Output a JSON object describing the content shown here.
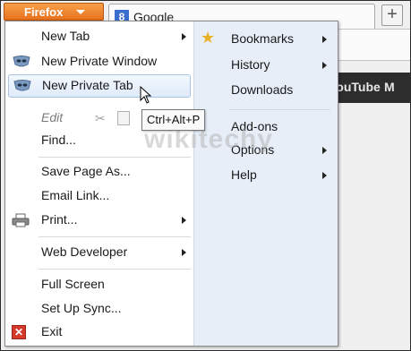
{
  "toolbar": {
    "app_menu_label": "Firefox",
    "tab_title": "Google",
    "tab_icon_letter": "8",
    "new_tab_symbol": "+"
  },
  "background_page": {
    "link_youtube": "YouTube",
    "link_more": "M"
  },
  "menu": {
    "left_items": [
      {
        "label": "New Tab",
        "icon": "none",
        "submenu": true
      },
      {
        "label": "New Private Window",
        "icon": "private-mask-icon",
        "submenu": false
      },
      {
        "label": "New Private Tab",
        "icon": "private-mask-icon",
        "submenu": false,
        "hovered": true
      },
      {
        "label": "Edit",
        "icon": "none",
        "disabled": true
      },
      {
        "label": "Find...",
        "icon": "none"
      },
      {
        "label": "Save Page As...",
        "icon": "none"
      },
      {
        "label": "Email Link...",
        "icon": "none"
      },
      {
        "label": "Print...",
        "icon": "printer-icon",
        "submenu": true
      },
      {
        "label": "Web Developer",
        "icon": "none",
        "submenu": true
      },
      {
        "label": "Full Screen",
        "icon": "none"
      },
      {
        "label": "Set Up Sync...",
        "icon": "none"
      },
      {
        "label": "Exit",
        "icon": "exit-icon"
      }
    ],
    "right_items": [
      {
        "label": "Bookmarks",
        "icon": "star-icon",
        "submenu": true
      },
      {
        "label": "History",
        "submenu": true
      },
      {
        "label": "Downloads",
        "submenu": false
      },
      {
        "label": "Add-ons",
        "submenu": false
      },
      {
        "label": "Options",
        "submenu": true
      },
      {
        "label": "Help",
        "submenu": true
      }
    ]
  },
  "tooltip": {
    "shortcut": "Ctrl+Alt+P"
  },
  "watermark": "wikitechy",
  "colors": {
    "firefox_orange": "#e8711d",
    "menu_hover_border": "#a8c3e8",
    "right_pane_bg": "#e7eef8",
    "star": "#e9b128",
    "exit_red": "#d33a2c"
  }
}
